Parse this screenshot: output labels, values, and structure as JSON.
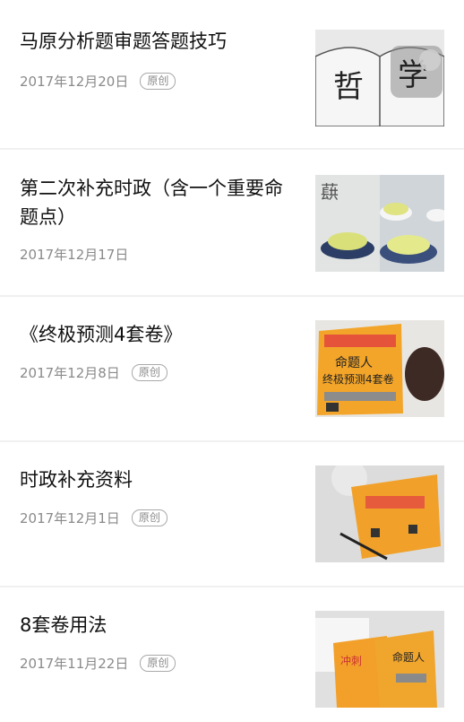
{
  "articles": [
    {
      "title": "马原分析题审题答题技巧",
      "date": "2017年12月20日",
      "badge": "原创",
      "thumb_icon": "book-philosophy-icon"
    },
    {
      "title": "第二次补充时政（含一个重要命题点）",
      "date": "2017年12月17日",
      "badge": "",
      "thumb_icon": "tea-cups-icon"
    },
    {
      "title": "《终极预测4套卷》",
      "date": "2017年12月8日",
      "badge": "原创",
      "thumb_icon": "exam-book-icon"
    },
    {
      "title": "时政补充资料",
      "date": "2017年12月1日",
      "badge": "原创",
      "thumb_icon": "exam-book-pen-icon"
    },
    {
      "title": "8套卷用法",
      "date": "2017年11月22日",
      "badge": "原创",
      "thumb_icon": "exam-books-stack-icon"
    }
  ],
  "thumb_text": {
    "philosophy_1": "哲",
    "philosophy_2": "学",
    "tea": "蕻",
    "book_title": "命题人",
    "book_subtitle": "终极预测4套卷",
    "stack_1": "命题人",
    "stack_2": "冲刺"
  }
}
